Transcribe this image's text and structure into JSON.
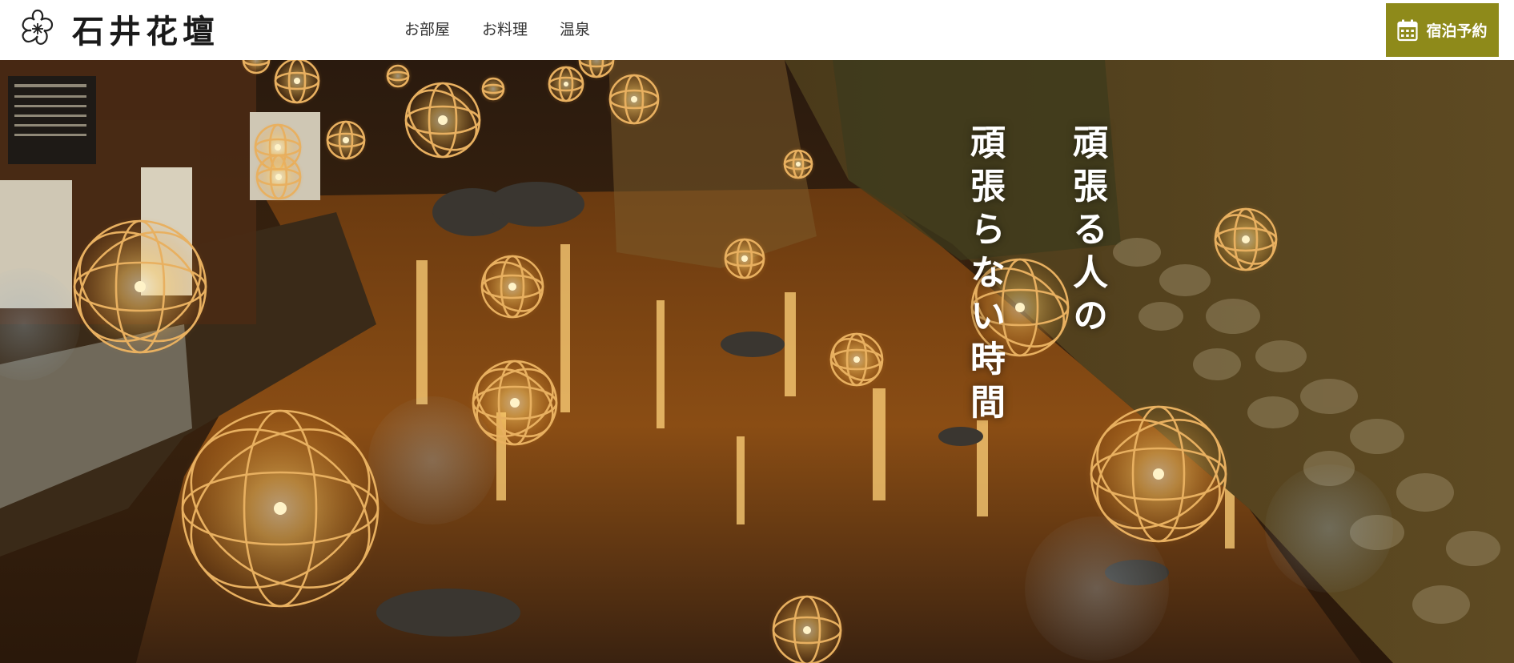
{
  "brand": {
    "name": "石井花壇",
    "logo_icon": "cherry-blossom-crest-icon"
  },
  "nav": [
    {
      "label": "お部屋"
    },
    {
      "label": "お料理"
    },
    {
      "label": "温泉"
    }
  ],
  "reserve": {
    "label": "宿泊予約",
    "icon": "calendar-icon",
    "color": "#8e8a1a"
  },
  "hero": {
    "catch_line_1": "頑張る人の",
    "catch_line_2": "頑張らない時間",
    "image_subject": "illuminated bamboo lanterns over a riverside at night"
  }
}
